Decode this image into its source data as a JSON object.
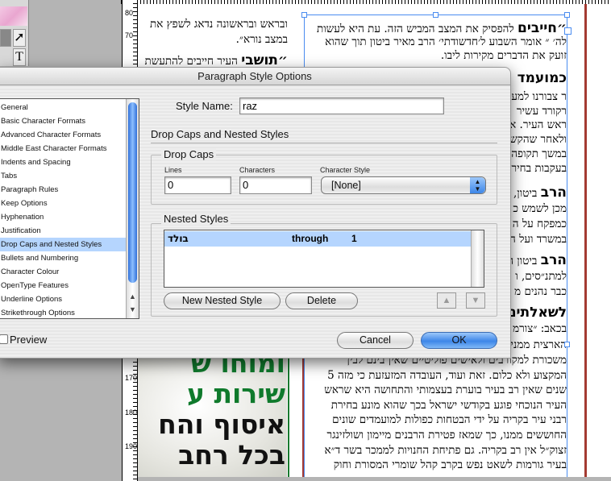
{
  "dialog": {
    "title": "Paragraph Style Options",
    "categories": [
      "General",
      "Basic Character Formats",
      "Advanced Character Formats",
      "Middle East Character Formats",
      "Indents and Spacing",
      "Tabs",
      "Paragraph Rules",
      "Keep Options",
      "Hyphenation",
      "Justification",
      "Drop Caps and Nested Styles",
      "Bullets and Numbering",
      "Character Colour",
      "OpenType Features",
      "Underline Options",
      "Strikethrough Options"
    ],
    "selected_category_index": 10,
    "style_name_label": "Style Name:",
    "style_name_value": "raz",
    "section_title": "Drop Caps and Nested Styles",
    "drop_caps": {
      "legend": "Drop Caps",
      "lines_label": "Lines",
      "lines_value": "0",
      "characters_label": "Characters",
      "characters_value": "0",
      "char_style_label": "Character Style",
      "char_style_value": "[None]"
    },
    "nested_styles": {
      "legend": "Nested Styles",
      "rows": [
        {
          "style": "בולד",
          "mode": "through",
          "count": "1"
        }
      ],
      "new_button": "New Nested Style",
      "delete_button": "Delete"
    },
    "preview_label": "Preview",
    "preview_checked": false,
    "cancel_button": "Cancel",
    "ok_button": "OK"
  },
  "document": {
    "left_column": [
      {
        "bold": "",
        "text": "ובראש ובראשונה נדאג לשפץ את"
      },
      {
        "bold": "",
        "text": "במצב נורא״."
      },
      {
        "bold": "״תושבי",
        "text": " העיר חייבים להתעשת"
      }
    ],
    "right_column": [
      {
        "bold": "״חייבים",
        "text": " להפסיק את המצב המביש הזה. עת היא לעשות"
      },
      {
        "bold": "",
        "text": "לה׳ ״ אומר השבוע ל׳חדשודתי׳ הרב מאיר ביטון תוך שהוא"
      },
      {
        "bold": "",
        "text": "זועק את הדברים מקירות ליבו."
      },
      {
        "bold": "כמועמד",
        "text": " "
      },
      {
        "bold": "",
        "text": "ר צבורנו למע"
      },
      {
        "bold": "",
        "text": "רקורד עשיר"
      },
      {
        "bold": "",
        "text": "ראש העיר. א"
      },
      {
        "bold": "",
        "text": "ולאחר שהקש"
      },
      {
        "bold": "",
        "text": "במשך תקופה"
      },
      {
        "bold": "",
        "text": "בעקבות בחיר"
      },
      {
        "bold": "הרב",
        "text": " ביטון,"
      },
      {
        "bold": "",
        "text": "מכן לשמש כ"
      },
      {
        "bold": "",
        "text": "כמפקח על ה"
      },
      {
        "bold": "",
        "text": "במשרד ועל ה"
      },
      {
        "bold": "הרב",
        "text": " ביטון ה"
      },
      {
        "bold": "",
        "text": "למתנ״סים, ו"
      },
      {
        "bold": "",
        "text": "כבר נהנים מ"
      },
      {
        "bold": "לשאלתינו",
        "text": ""
      },
      {
        "bold": "",
        "text": "בכאב: ״צורמ"
      },
      {
        "bold": "",
        "text": "הארצית ממני"
      },
      {
        "bold": "",
        "text": "משכורת למקורבים ולאישים פוליטיים שאין בינם לבין"
      },
      {
        "bold": "",
        "text": "המקצוע ולא כלום. זאת ועוד, העובדה המזעזעת כי מזה 5"
      },
      {
        "bold": "",
        "text": "שנים שאין רב בעיר בוערת בעצמותי והתחושה היא שראש"
      },
      {
        "bold": "",
        "text": "העיר הנוכחי פוגע בקודשי ישראל בכך שהוא מונע בחירת"
      },
      {
        "bold": "",
        "text": "רבני עיר בקריה על ידי הבטחות כפולות למועמדים שונים"
      },
      {
        "bold": "",
        "text": "החוששים ממנו, כך שמאז פטירת הרבנים מיימון ושולזינגר"
      },
      {
        "bold": "",
        "text": "זצוק״ל אין רב בקריה. גם פתיחת החנויות לממכר בשר ד״א"
      },
      {
        "bold": "",
        "text": "בעיר גורמות לשאט נפש בקרב קהל שומרי המסורת וחוק"
      }
    ],
    "photo_lines": [
      {
        "text": "ומוחו ש",
        "color": "#0f7a2c"
      },
      {
        "text": "שירות ע",
        "color": "#0f7a2c"
      },
      {
        "text": "איסוף והח",
        "color": "#111111"
      },
      {
        "text": "בכל רחב",
        "color": "#111111"
      }
    ],
    "ruler_labels": [
      "80",
      "70",
      "170",
      "180",
      "190"
    ]
  },
  "colors": {
    "selection": "#b5d5fe",
    "accent": "#3d86e8",
    "margin_red": "#a43a32"
  }
}
